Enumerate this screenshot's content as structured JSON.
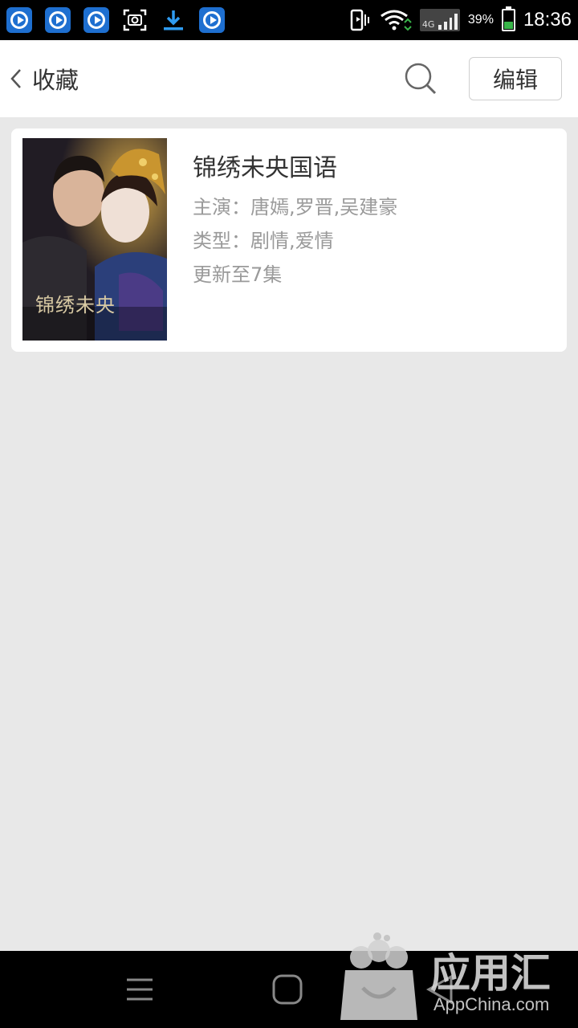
{
  "status_bar": {
    "battery_percent": "39%",
    "network": "4G",
    "time": "18:36"
  },
  "header": {
    "title": "收藏",
    "edit_label": "编辑"
  },
  "favorites": [
    {
      "title": "锦绣未央国语",
      "cast": "主演：唐嫣,罗晋,吴建豪",
      "genre": "类型：剧情,爱情",
      "episodes": "更新至7集",
      "poster_text": "锦绣未央"
    }
  ],
  "watermark": {
    "brand_cn": "应用汇",
    "brand_en": "AppChina.com"
  }
}
